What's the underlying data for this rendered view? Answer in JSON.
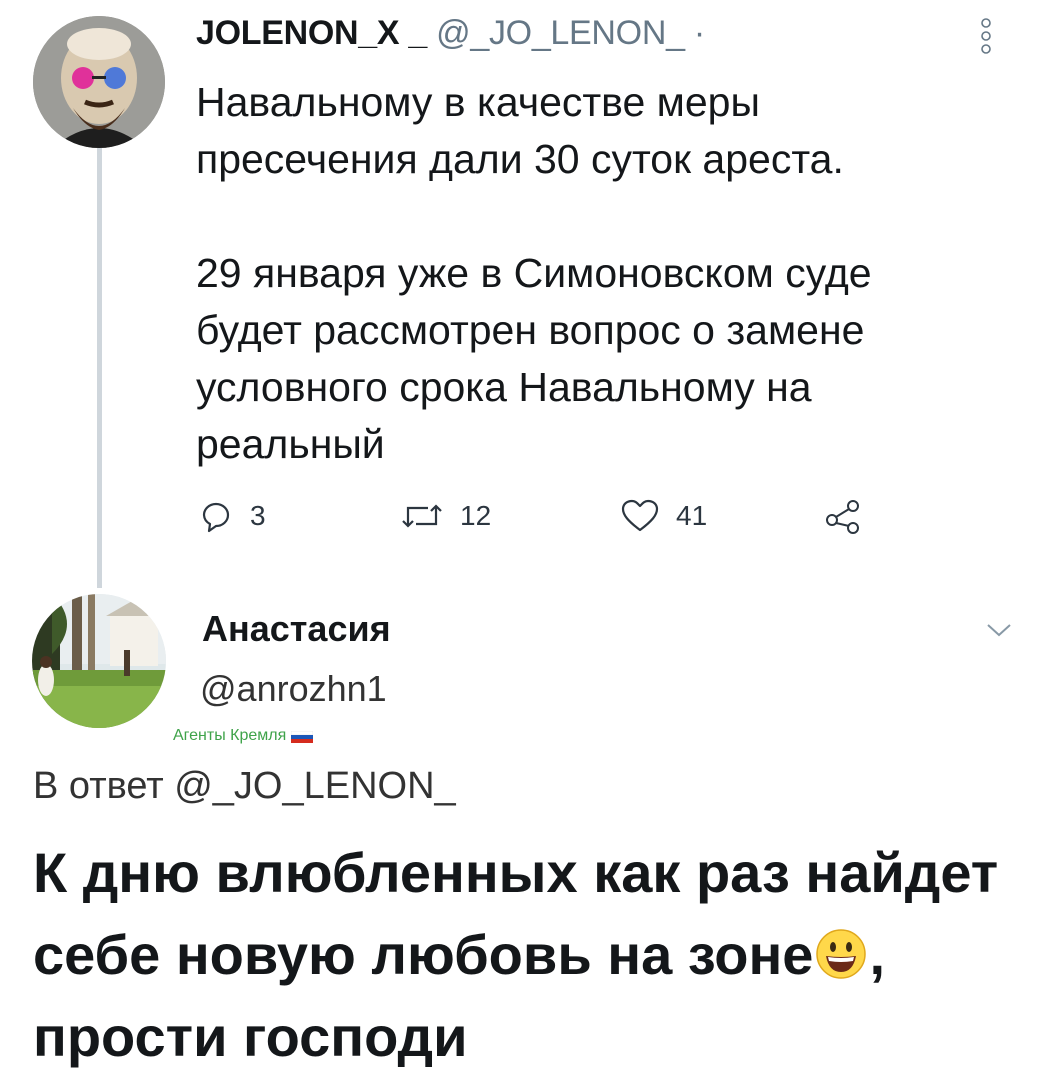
{
  "tweet1": {
    "author_name": "JOLENON_X _",
    "handle": "@_JO_LENON_",
    "separator": "·",
    "text_paragraph1": "Навальному в качестве меры\nпресечения дали 30 суток ареста.",
    "text_paragraph2": "29 января уже в Симоновском суде\nбудет рассмотрен вопрос о замене\nусловного срока Навальному на\nреальный",
    "actions": {
      "reply_count": "3",
      "retweet_count": "12",
      "like_count": "41"
    },
    "icons": [
      "avatar",
      "more-vertical-icon",
      "reply-icon",
      "retweet-icon",
      "like-icon",
      "share-icon"
    ]
  },
  "tweet2": {
    "author_name": "Анастасия",
    "handle": "@anrozhn1",
    "badge_text": "Агенты Кремля",
    "reply_prefix": "В ответ",
    "reply_handle": "@_JO_LENON_",
    "text_part1": "К дню влюбленных как раз найдет себе новую любовь на зоне",
    "text_part2": ", прости господи",
    "icons": [
      "avatar",
      "chevron-down-icon",
      "flag-icon",
      "grinning-emoji-icon"
    ]
  },
  "colors": {
    "text": "#14171a",
    "secondary": "#657786",
    "thread_line": "#cfd6dc",
    "badge_green": "#3fa34a"
  }
}
